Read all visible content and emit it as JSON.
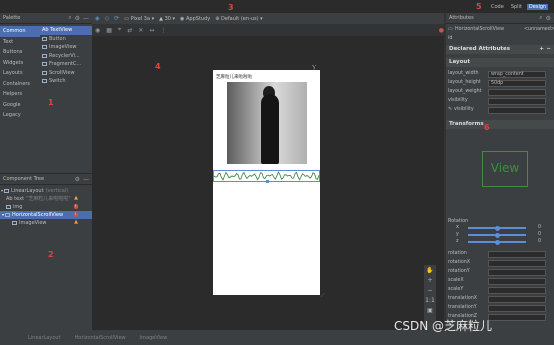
{
  "palette": {
    "title": "Palette",
    "categories": [
      "Common",
      "Text",
      "Buttons",
      "Widgets",
      "Layouts",
      "Containers",
      "Helpers",
      "Google",
      "Legacy"
    ],
    "widgets": [
      "Ab TextView",
      "Button",
      "ImageView",
      "RecyclerVi...",
      "FragmentC...",
      "ScrollView",
      "Switch"
    ]
  },
  "component_tree": {
    "title": "Component Tree",
    "nodes": [
      {
        "label": "LinearLayout",
        "note": "(vertical)"
      },
      {
        "label": "Ab text",
        "note": "\"芝麻粒儿来啦啦啦\""
      },
      {
        "label": "img",
        "note": ""
      },
      {
        "label": "HorizontalScrollView",
        "note": ""
      },
      {
        "label": "ImageView",
        "note": ""
      }
    ]
  },
  "toolbar": {
    "device": "Pixel 3a",
    "api": "30",
    "theme": "AppStudy",
    "locale": "Default (en-us)"
  },
  "preview": {
    "title_text": "芝麻粒儿来啦啦啦"
  },
  "view_modes": [
    "Code",
    "Split",
    "Design"
  ],
  "attributes": {
    "title": "Attributes",
    "component": "HorizontalScrollView",
    "id_value": "<unnamed>",
    "declared_label": "Declared Attributes",
    "layout_label": "Layout",
    "rows": [
      {
        "name": "layout_width",
        "value": "wrap_content"
      },
      {
        "name": "layout_height",
        "value": "50dp"
      },
      {
        "name": "layout_weight",
        "value": ""
      },
      {
        "name": "visibility",
        "value": ""
      },
      {
        "name": "visibility",
        "value": ""
      }
    ],
    "transforms_label": "Transforms",
    "preview_text": "View",
    "rotation_label": "Rotation",
    "axes": [
      {
        "name": "x",
        "value": "0",
        "level": 0.5
      },
      {
        "name": "y",
        "value": "0",
        "level": 0.5
      },
      {
        "name": "z",
        "value": "0",
        "level": 0.5
      }
    ],
    "transform_fields": [
      "rotation",
      "rotationX",
      "rotationY",
      "scaleX",
      "scaleY",
      "translationX",
      "translationY",
      "translationZ"
    ]
  },
  "status": {
    "breadcrumbs": [
      "LinearLayout",
      "HorizontalScrollView",
      "ImageView"
    ]
  },
  "annotations": [
    "1",
    "2",
    "3",
    "4",
    "5",
    "6"
  ],
  "watermark": "CSDN @芝麻粒儿",
  "colors": {
    "selection": "#4b6eaf",
    "accent": "#5b8ed6",
    "annotation": "#e0443e",
    "view_preview": "#3e8e41"
  }
}
